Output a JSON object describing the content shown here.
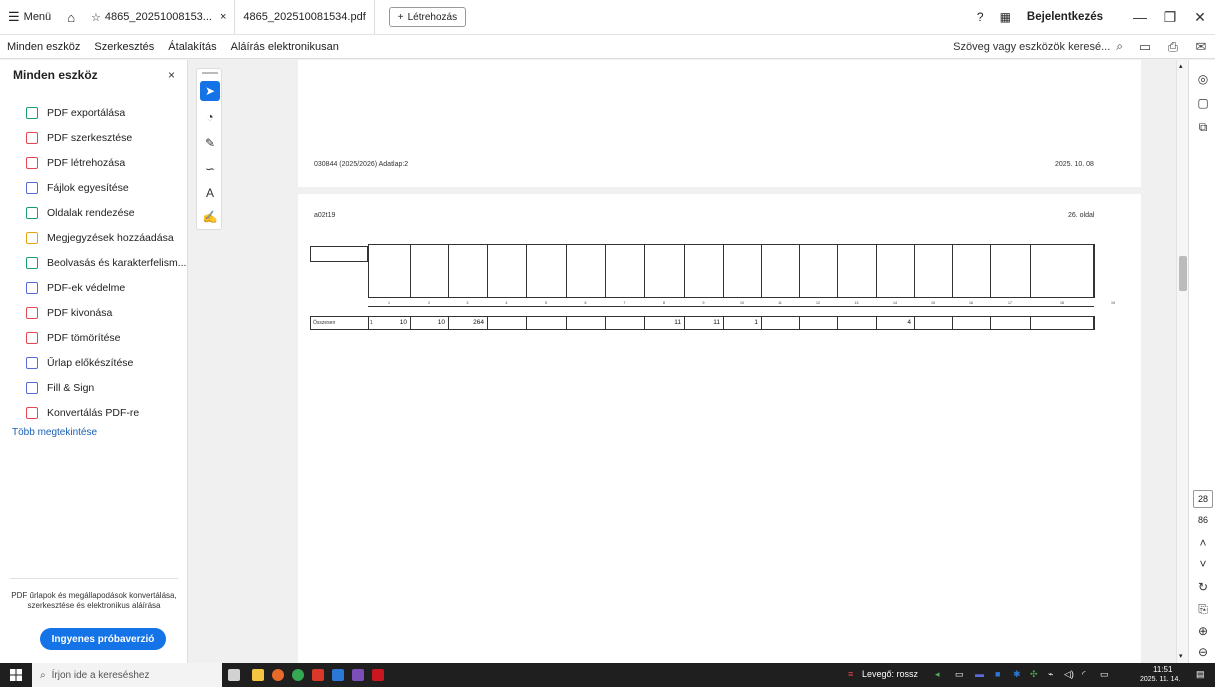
{
  "titlebar": {
    "menu_label": "Menü",
    "tab1_label": "4865_20251008153...",
    "tab1_close": "×",
    "tab2_label": "4865_20251008153​4.pdf",
    "create_label": "Létrehozás",
    "login_label": "Bejelentkezés",
    "min": "—",
    "max": "❐",
    "close": "✕"
  },
  "toolbar": {
    "menus": [
      "Minden eszköz",
      "Szerkesztés",
      "Átalakítás",
      "Aláírás elektronikusan"
    ],
    "search_placeholder": "Szöveg vagy eszközök keresé..."
  },
  "sidebar": {
    "title": "Minden eszköz",
    "close": "×",
    "items": [
      {
        "label": "PDF exportálása",
        "icon": "export-pdf-icon",
        "color": "#1a9e6b"
      },
      {
        "label": "PDF szerkesztése",
        "icon": "edit-pdf-icon",
        "color": "#e34850"
      },
      {
        "label": "PDF létrehozása",
        "icon": "create-pdf-icon",
        "color": "#e34850"
      },
      {
        "label": "Fájlok egyesítése",
        "icon": "combine-icon",
        "color": "#5b6ad6"
      },
      {
        "label": "Oldalak rendezése",
        "icon": "organize-icon",
        "color": "#1a9e6b"
      },
      {
        "label": "Megjegyzések hozzáadása",
        "icon": "comment-icon",
        "color": "#e8a315"
      },
      {
        "label": "Beolvasás és karakterfelism...",
        "icon": "scan-icon",
        "color": "#1a9e6b"
      },
      {
        "label": "PDF-ek védelme",
        "icon": "protect-icon",
        "color": "#5b6ad6"
      },
      {
        "label": "PDF kivonása",
        "icon": "extract-icon",
        "color": "#e34850"
      },
      {
        "label": "PDF tömörítése",
        "icon": "compress-icon",
        "color": "#e34850"
      },
      {
        "label": "Űrlap előkészítése",
        "icon": "form-icon",
        "color": "#5b6ad6"
      },
      {
        "label": "Fill & Sign",
        "icon": "fill-sign-icon",
        "color": "#5b6ad6"
      },
      {
        "label": "Konvertálás PDF-re",
        "icon": "convert-icon",
        "color": "#e34850"
      }
    ],
    "more_link": "Több megtekintése",
    "promo_text": "PDF űrlapok és megállapodások konvertálása, szerkesztése és elektronikus aláírása",
    "trial_button": "Ingyenes próbaverzió"
  },
  "document": {
    "page1_footer_left": "030844 (2025/2026) Adatlap:2",
    "page1_footer_right": "2025. 10. 08",
    "page2_header_left": "a02t19",
    "page2_header_right": "26. oldal",
    "row_label": "Összesen",
    "row_number": "1",
    "column_numbers": [
      "1",
      "2",
      "3",
      "4",
      "5",
      "6",
      "7",
      "8",
      "9",
      "10",
      "11",
      "12",
      "13",
      "14",
      "15",
      "16",
      "17",
      "18",
      "19"
    ],
    "row_values": [
      "10",
      "10",
      "264",
      "",
      "",
      "",
      "",
      "11",
      "11",
      "1",
      "",
      "",
      "",
      "4",
      "",
      "",
      "",
      "",
      ""
    ]
  },
  "rightrail": {
    "page_current": "28",
    "page_total": "86"
  },
  "taskbar": {
    "search_placeholder": "Írjon ide a kereséshez",
    "weather": "Levegő: rossz",
    "time": "11:51",
    "date": "2025. 11. 14."
  }
}
